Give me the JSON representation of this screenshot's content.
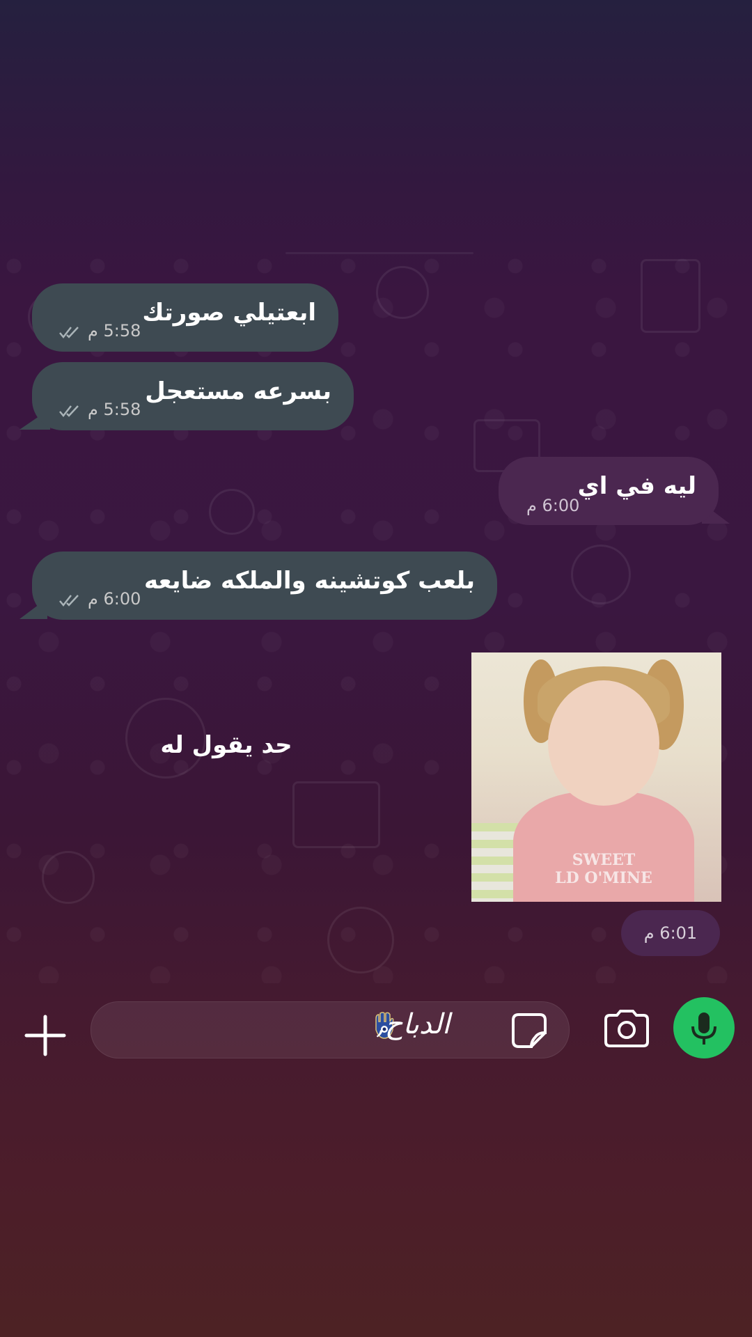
{
  "messages": [
    {
      "direction": "incoming",
      "text": "ابعتيلي صورتك",
      "time": "5:58 م",
      "status": "read"
    },
    {
      "direction": "incoming",
      "text": "بسرعه مستعجل",
      "time": "5:58 م",
      "status": "read"
    },
    {
      "direction": "outgoing",
      "text": "ليه في اي",
      "time": "6:00 م"
    },
    {
      "direction": "incoming",
      "text": "بلعب كوتشينه والملكه ضايعه",
      "time": "6:00 م",
      "status": "read"
    },
    {
      "direction": "outgoing",
      "type": "image",
      "caption": "حد يقول له",
      "image_text": "SWEET\nLD O'MINE",
      "time": "6:01 م"
    }
  ],
  "composer": {
    "text": "الدباح,",
    "icons": [
      "plus-icon",
      "sticker-icon",
      "camera-icon",
      "microphone-icon"
    ]
  },
  "colors": {
    "incoming_bubble": "#3e4a52",
    "outgoing_bubble": "#4b2750",
    "mic_button": "#23c161"
  }
}
